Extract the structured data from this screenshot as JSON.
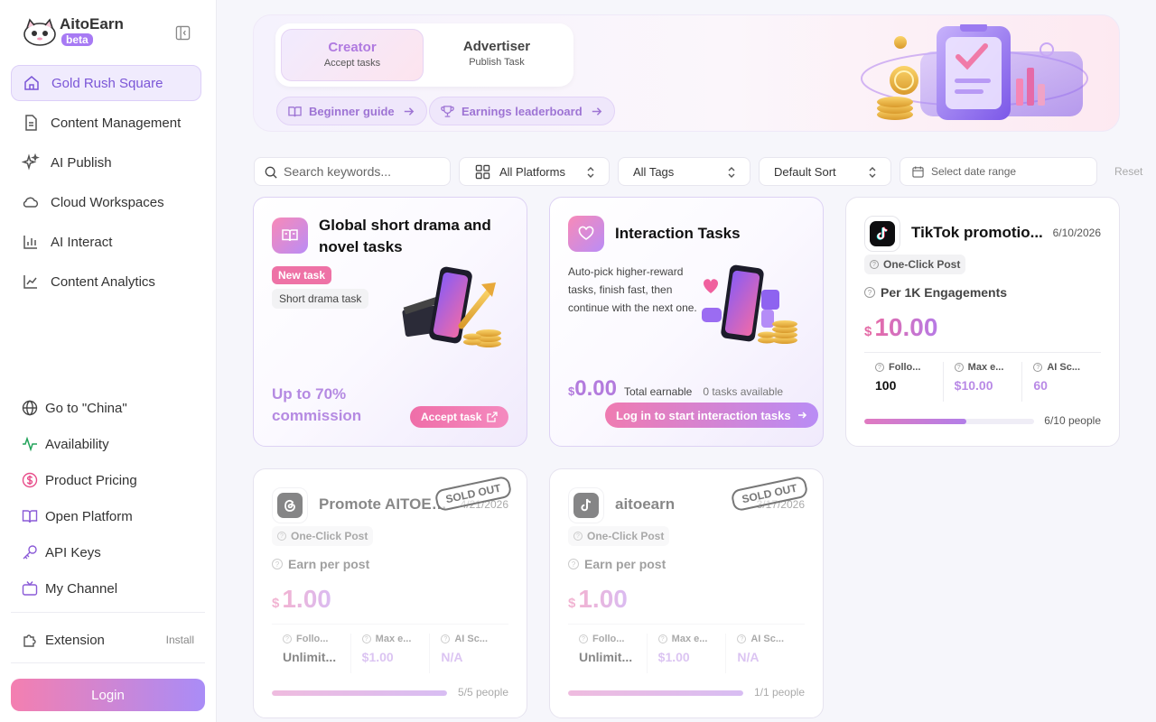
{
  "app": {
    "name": "AitoEarn",
    "badge": "beta"
  },
  "sidebar": {
    "items": [
      {
        "label": "Gold Rush Square",
        "icon": "home-icon",
        "active": true
      },
      {
        "label": "Content Management",
        "icon": "document-icon"
      },
      {
        "label": "AI Publish",
        "icon": "sparkle-icon"
      },
      {
        "label": "Cloud Workspaces",
        "icon": "cloud-icon"
      },
      {
        "label": "AI Interact",
        "icon": "bar-chart-icon"
      },
      {
        "label": "Content Analytics",
        "icon": "line-chart-icon"
      }
    ],
    "bottom": [
      {
        "label": "Go to \"China\"",
        "icon": "globe-icon"
      },
      {
        "label": "Availability",
        "icon": "activity-icon",
        "color": "#22a35a"
      },
      {
        "label": "Product Pricing",
        "icon": "dollar-circle-icon",
        "color": "#e84d8a"
      },
      {
        "label": "Open Platform",
        "icon": "book-icon",
        "color": "#8a5ad7"
      },
      {
        "label": "API Keys",
        "icon": "key-icon",
        "color": "#8a5ad7"
      },
      {
        "label": "My Channel",
        "icon": "tv-icon",
        "color": "#8a5ad7"
      }
    ],
    "extension": {
      "label": "Extension",
      "action": "Install"
    },
    "login": "Login"
  },
  "hero": {
    "roles": [
      {
        "title": "Creator",
        "subtitle": "Accept tasks",
        "active": true
      },
      {
        "title": "Advertiser",
        "subtitle": "Publish Task",
        "active": false
      }
    ],
    "links": [
      {
        "label": "Beginner guide",
        "icon": "book-open-icon"
      },
      {
        "label": "Earnings leaderboard",
        "icon": "trophy-icon"
      }
    ]
  },
  "filters": {
    "search_placeholder": "Search keywords...",
    "platform": "All Platforms",
    "tags": "All Tags",
    "sort": "Default Sort",
    "date_placeholder": "Select date range",
    "reset": "Reset"
  },
  "cards": {
    "drama": {
      "title": "Global short drama and novel tasks",
      "tag_new": "New task",
      "tag_type": "Short drama task",
      "commission": "Up to 70% commission",
      "button": "Accept task"
    },
    "interaction": {
      "title": "Interaction Tasks",
      "description": "Auto-pick higher-reward tasks, finish fast, then continue with the next one.",
      "currency": "$",
      "amount": "0.00",
      "earnable_label": "Total earnable",
      "tasks_available": "0 tasks available",
      "button": "Log in to start interaction tasks"
    },
    "tasks": [
      {
        "platform": "TikTok",
        "icon": "tiktok-icon",
        "title": "TikTok promotio...",
        "date": "6/10/2026",
        "type": "One-Click Post",
        "metric": "Per 1K Engagements",
        "currency": "$",
        "price": "10.00",
        "stats": [
          {
            "label": "Follo...",
            "value": "100"
          },
          {
            "label": "Max e...",
            "value": "$10.00"
          },
          {
            "label": "AI Sc...",
            "value": "60"
          }
        ],
        "progress": 0.6,
        "people": "6/10 people",
        "sold_out": false
      },
      {
        "platform": "Threads",
        "icon": "threads-icon",
        "title": "Promote AITOEARN",
        "date": "4/21/2026",
        "type": "One-Click Post",
        "metric": "Earn per post",
        "currency": "$",
        "price": "1.00",
        "stats": [
          {
            "label": "Follo...",
            "value": "Unlimit..."
          },
          {
            "label": "Max e...",
            "value": "$1.00"
          },
          {
            "label": "AI Sc...",
            "value": "N/A"
          }
        ],
        "progress": 1.0,
        "people": "5/5 people",
        "sold_out": true,
        "sold_out_label": "SOLD OUT"
      },
      {
        "platform": "TikTok",
        "icon": "tiktok-icon",
        "title": "aitoearn",
        "date": "3/17/2026",
        "type": "One-Click Post",
        "metric": "Earn per post",
        "currency": "$",
        "price": "1.00",
        "stats": [
          {
            "label": "Follo...",
            "value": "Unlimit..."
          },
          {
            "label": "Max e...",
            "value": "$1.00"
          },
          {
            "label": "AI Sc...",
            "value": "N/A"
          }
        ],
        "progress": 1.0,
        "people": "1/1 people",
        "sold_out": true,
        "sold_out_label": "SOLD OUT"
      }
    ]
  },
  "colors": {
    "accent": "#8a5ad7",
    "pink": "#ee72a6",
    "active_bg": "#f0ebfd"
  }
}
